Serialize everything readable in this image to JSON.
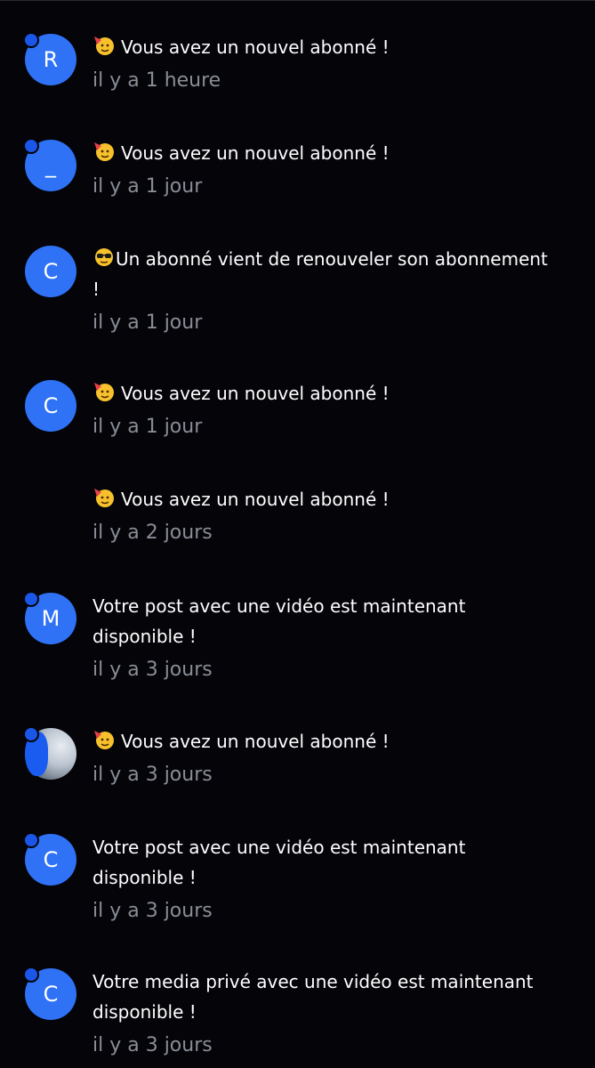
{
  "notifications": [
    {
      "avatar": "R",
      "avatar_style": "letter",
      "emoji": "party-face-icon",
      "message": "Vous avez un nouvel abonné !",
      "time": "il y a 1 heure"
    },
    {
      "avatar": "_",
      "avatar_style": "letter",
      "emoji": "party-face-icon",
      "message": "Vous avez un nouvel abonné !",
      "time": "il y a 1 jour"
    },
    {
      "avatar": "C",
      "avatar_style": "letter",
      "emoji": "sunglasses-face-icon",
      "message": "Un abonné vient de renouveler son abonnement !",
      "time": "il y a 1 jour"
    },
    {
      "avatar": "C",
      "avatar_style": "letter",
      "emoji": "party-face-icon",
      "message": "Vous avez un nouvel abonné !",
      "time": "il y a 1 jour"
    },
    {
      "avatar": "",
      "avatar_style": "none",
      "emoji": "party-face-icon",
      "message": "Vous avez un nouvel abonné !",
      "time": "il y a 2 jours"
    },
    {
      "avatar": "M",
      "avatar_style": "letter",
      "emoji": "",
      "message": "Votre post avec une vidéo est maintenant disponible !",
      "time": "il y a 3 jours"
    },
    {
      "avatar": "",
      "avatar_style": "photo",
      "emoji": "party-face-icon",
      "message": "Vous avez un nouvel abonné !",
      "time": "il y a 3 jours"
    },
    {
      "avatar": "C",
      "avatar_style": "letter",
      "emoji": "",
      "message": "Votre post avec une vidéo est maintenant disponible !",
      "time": "il y a 3 jours"
    },
    {
      "avatar": "C",
      "avatar_style": "letter",
      "emoji": "",
      "message": "Votre media privé avec une vidéo est maintenant disponible !",
      "time": "il y a 3 jours"
    }
  ],
  "colors": {
    "background": "#040409",
    "avatar": "#2f72f5",
    "message": "#ffffff",
    "time": "#8a8d95"
  }
}
